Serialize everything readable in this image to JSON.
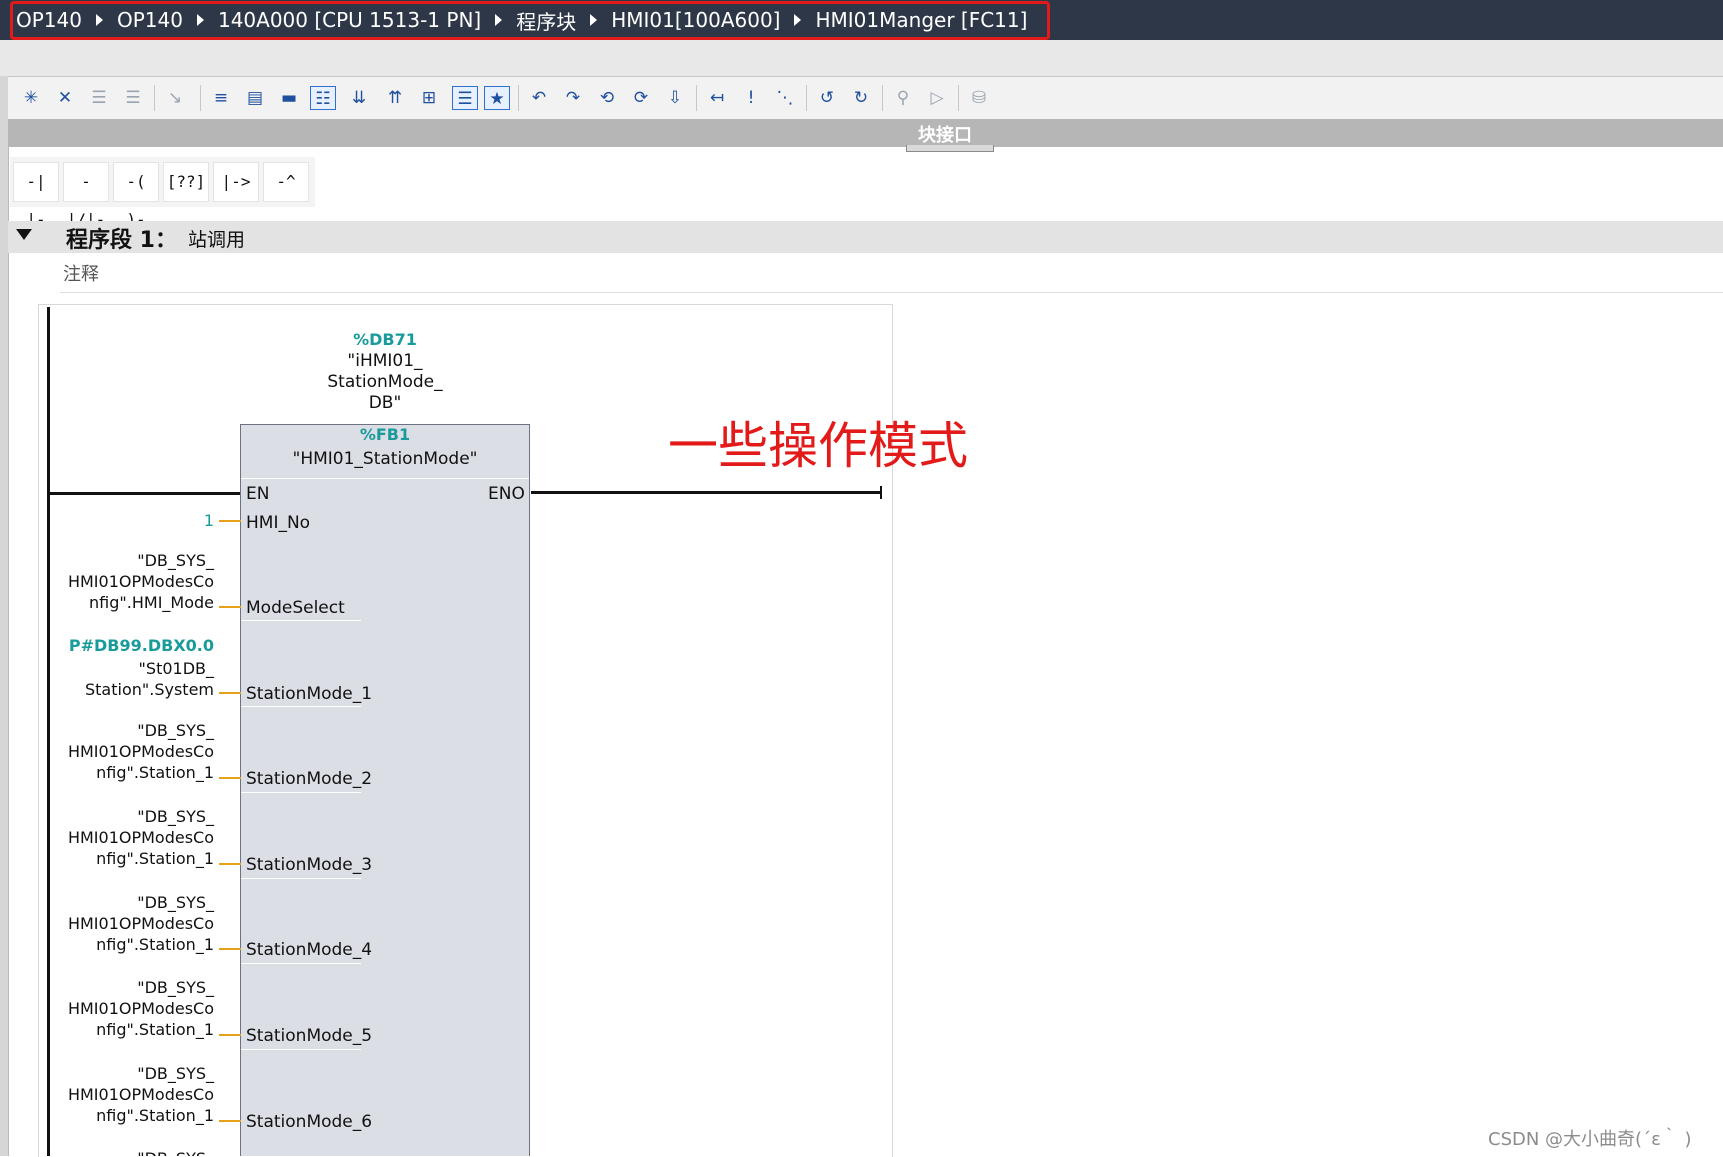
{
  "breadcrumb": [
    "OP140",
    "OP140",
    "140A000 [CPU 1513-1 PN]",
    "程序块",
    "HMI01[100A600]",
    "HMI01Manger [FC11]"
  ],
  "toolbar_icons": [
    "insert-network-icon",
    "delete-network-icon",
    "insert-row-icon",
    "append-row-icon",
    "go-to-icon",
    "absolute-operands-icon",
    "favorites-icon",
    "block-view-icon",
    "comments-icon",
    "network-open-icon",
    "network-close-icon",
    "network-zoom-icon",
    "list-view-icon",
    "favorite-star-icon",
    "go-to-error-icon",
    "next-error-icon",
    "prev-error-icon",
    "update-call-icon",
    "monitor-icon",
    "call-hierarchy-icon",
    "step-in-icon",
    "step-out-icon",
    "refresh-icon",
    "undo-icon",
    "watch-icon",
    "test-icon",
    "database-icon"
  ],
  "interface": {
    "label": "块接口"
  },
  "ladder_tools": [
    "-| |-",
    "-|/|-",
    "-( )-",
    "[??]",
    "|->",
    "-^"
  ],
  "network": {
    "title": "程序段 1：",
    "description": "站调用",
    "comment": "注释"
  },
  "instance": {
    "address": "%DB71",
    "name": "\"iHMI01_\nStationMode_\nDB\""
  },
  "fb": {
    "address": "%FB1",
    "name": "\"HMI01_StationMode\""
  },
  "pins": {
    "en": "EN",
    "eno": "ENO",
    "hmi_no": "HMI_No",
    "mode_select": "ModeSelect",
    "sm1": "StationMode_1",
    "sm2": "StationMode_2",
    "sm3": "StationMode_3",
    "sm4": "StationMode_4",
    "sm5": "StationMode_5",
    "sm6": "StationMode_6"
  },
  "params": {
    "hmi_no": "1",
    "mode_select": "\"DB_SYS_\nHMI01OPModesCo\nnfig\".HMI_Mode",
    "sm1_addr": "P#DB99.DBX0.0",
    "sm1": "\"St01DB_\nStation\".System",
    "sm2": "\"DB_SYS_\nHMI01OPModesCo\nnfig\".Station_1",
    "sm3": "\"DB_SYS_\nHMI01OPModesCo\nnfig\".Station_1",
    "sm4": "\"DB_SYS_\nHMI01OPModesCo\nnfig\".Station_1",
    "sm5": "\"DB_SYS_\nHMI01OPModesCo\nnfig\".Station_1",
    "sm6": "\"DB_SYS_\nHMI01OPModesCo\nnfig\".Station_1",
    "sm7_partial": "\"DB_SYS_"
  },
  "annotation": "一些操作模式",
  "watermark": "CSDN @大小曲奇(´ε｀ )",
  "colors": {
    "breadcrumb_bg": "#2d3748",
    "highlight": "#e31a1a",
    "address": "#1a9b9b",
    "wire": "#e7a21a",
    "fb_fill": "#dcdee6"
  }
}
